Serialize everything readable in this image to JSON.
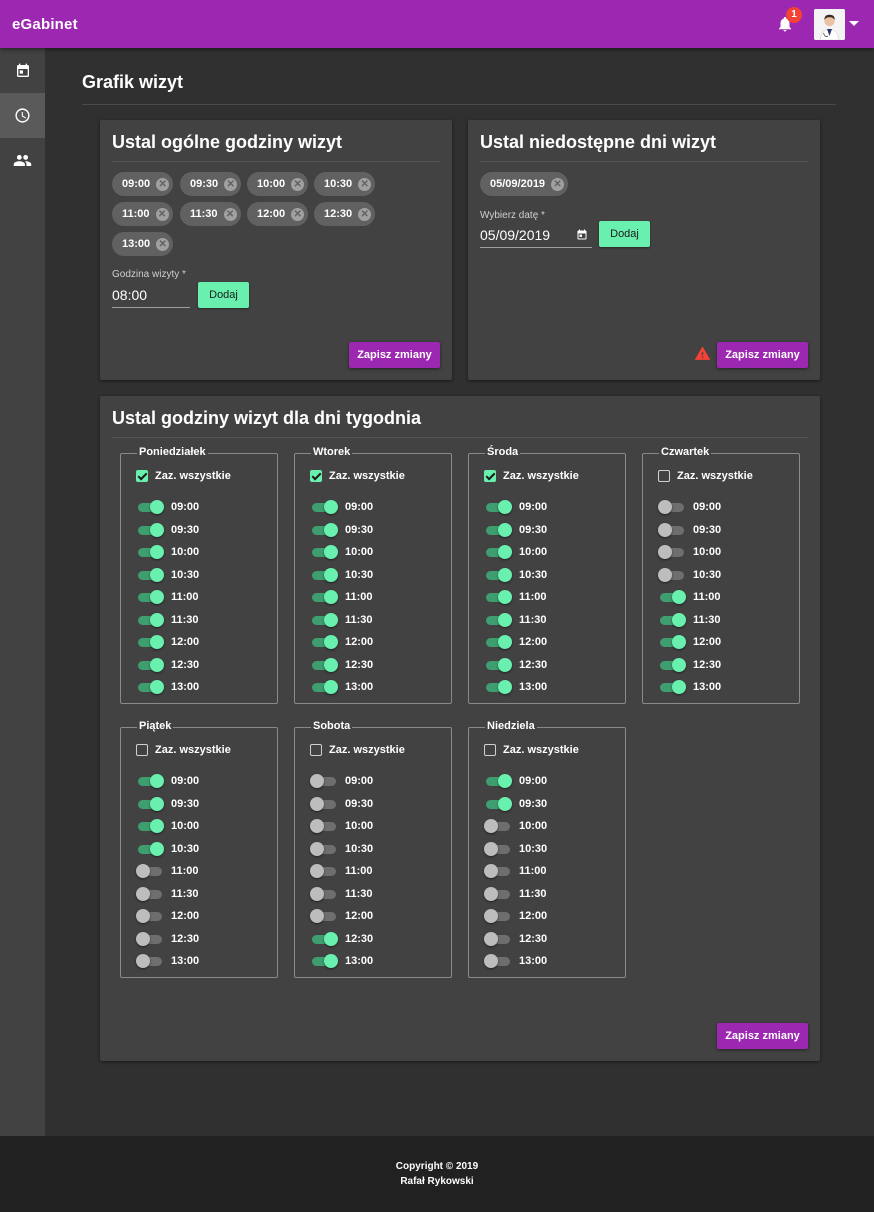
{
  "app": {
    "brand": "eGabinet",
    "notification_count": "1"
  },
  "sidebar": {
    "items": [
      {
        "icon": "calendar-icon"
      },
      {
        "icon": "clock-icon",
        "active": true
      },
      {
        "icon": "people-icon"
      }
    ]
  },
  "page": {
    "title": "Grafik wizyt"
  },
  "general_hours": {
    "title": "Ustal ogólne godziny wizyt",
    "chips": [
      "09:00",
      "09:30",
      "10:00",
      "10:30",
      "11:00",
      "11:30",
      "12:00",
      "12:30",
      "13:00"
    ],
    "input_label": "Godzina wizyty *",
    "input_value": "08:00",
    "add_label": "Dodaj",
    "save_label": "Zapisz zmiany"
  },
  "unavailable_days": {
    "title": "Ustal niedostępne dni wizyt",
    "chips": [
      "05/09/2019"
    ],
    "input_label": "Wybierz datę *",
    "input_value": "05/09/2019",
    "add_label": "Dodaj",
    "save_label": "Zapisz zmiany"
  },
  "weekdays": {
    "title": "Ustal godziny wizyt dla dni tygodnia",
    "select_all_label": "Zaz. wszystkie",
    "save_label": "Zapisz zmiany",
    "days": [
      {
        "name": "Poniedziałek",
        "all": true,
        "slots": [
          [
            "09:00",
            true
          ],
          [
            "09:30",
            true
          ],
          [
            "10:00",
            true
          ],
          [
            "10:30",
            true
          ],
          [
            "11:00",
            true
          ],
          [
            "11:30",
            true
          ],
          [
            "12:00",
            true
          ],
          [
            "12:30",
            true
          ],
          [
            "13:00",
            true
          ]
        ]
      },
      {
        "name": "Wtorek",
        "all": true,
        "slots": [
          [
            "09:00",
            true
          ],
          [
            "09:30",
            true
          ],
          [
            "10:00",
            true
          ],
          [
            "10:30",
            true
          ],
          [
            "11:00",
            true
          ],
          [
            "11:30",
            true
          ],
          [
            "12:00",
            true
          ],
          [
            "12:30",
            true
          ],
          [
            "13:00",
            true
          ]
        ]
      },
      {
        "name": "Środa",
        "all": true,
        "slots": [
          [
            "09:00",
            true
          ],
          [
            "09:30",
            true
          ],
          [
            "10:00",
            true
          ],
          [
            "10:30",
            true
          ],
          [
            "11:00",
            true
          ],
          [
            "11:30",
            true
          ],
          [
            "12:00",
            true
          ],
          [
            "12:30",
            true
          ],
          [
            "13:00",
            true
          ]
        ]
      },
      {
        "name": "Czwartek",
        "all": false,
        "slots": [
          [
            "09:00",
            false
          ],
          [
            "09:30",
            false
          ],
          [
            "10:00",
            false
          ],
          [
            "10:30",
            false
          ],
          [
            "11:00",
            true
          ],
          [
            "11:30",
            true
          ],
          [
            "12:00",
            true
          ],
          [
            "12:30",
            true
          ],
          [
            "13:00",
            true
          ]
        ]
      },
      {
        "name": "Piątek",
        "all": false,
        "slots": [
          [
            "09:00",
            true
          ],
          [
            "09:30",
            true
          ],
          [
            "10:00",
            true
          ],
          [
            "10:30",
            true
          ],
          [
            "11:00",
            false
          ],
          [
            "11:30",
            false
          ],
          [
            "12:00",
            false
          ],
          [
            "12:30",
            false
          ],
          [
            "13:00",
            false
          ]
        ]
      },
      {
        "name": "Sobota",
        "all": false,
        "slots": [
          [
            "09:00",
            false
          ],
          [
            "09:30",
            false
          ],
          [
            "10:00",
            false
          ],
          [
            "10:30",
            false
          ],
          [
            "11:00",
            false
          ],
          [
            "11:30",
            false
          ],
          [
            "12:00",
            false
          ],
          [
            "12:30",
            true
          ],
          [
            "13:00",
            true
          ]
        ]
      },
      {
        "name": "Niedziela",
        "all": false,
        "slots": [
          [
            "09:00",
            true
          ],
          [
            "09:30",
            true
          ],
          [
            "10:00",
            false
          ],
          [
            "10:30",
            false
          ],
          [
            "11:00",
            false
          ],
          [
            "11:30",
            false
          ],
          [
            "12:00",
            false
          ],
          [
            "12:30",
            false
          ],
          [
            "13:00",
            false
          ]
        ]
      }
    ]
  },
  "footer": {
    "line1": "Copyright © 2019",
    "line2": "Rafał Rykowski"
  },
  "colors": {
    "primary": "#9c27b0",
    "accent": "#69f0ae",
    "warn": "#f44336",
    "card": "#424242",
    "background": "#303030"
  }
}
